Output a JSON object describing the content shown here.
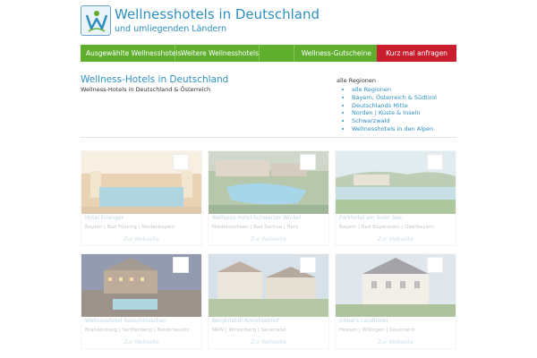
{
  "header": {
    "title": "Wellnesshotels in Deutschland",
    "subtitle": "und umliegenden Ländern",
    "logo_icon": "wellness-logo-icon"
  },
  "nav": {
    "items": [
      {
        "label": "Ausgewählte Wellnesshotels"
      },
      {
        "label": "Weitere Wellnesshotels"
      },
      {
        "label": "Wellness-Gutscheine"
      }
    ],
    "cta_label": "Kurz mal anfragen",
    "colors": {
      "nav_bg": "#5fae2e",
      "cta_bg": "#c81e2e",
      "accent": "#2f8fc0"
    }
  },
  "main": {
    "title": "Wellness-Hotels in Deutschland",
    "subtitle": "Wellness-Hotels in Deutschland & Österreich"
  },
  "regions": {
    "heading": "alle Regionen",
    "items": [
      "alle Regionen",
      "Bayern, Österreich & Südtirol",
      "Deutschlands Mitte",
      "Norden | Küste & Inseln",
      "Schwarzwald",
      "Wellnesshotels in den Alpen"
    ]
  },
  "hotels": [
    {
      "name": "Hotel Erlanger",
      "location": "Bayern | Bad Füssing | Niederbayern",
      "link": "Zur Webseite"
    },
    {
      "name": "Wellness Hotel Schwarzer Winkel",
      "location": "Niedersachsen | Bad Sachsa | Harz",
      "link": "Zur Webseite"
    },
    {
      "name": "Parkhotel am Soier See",
      "location": "Bayern | Bad Bayersoien | Oberbayern",
      "link": "Zur Webseite"
    },
    {
      "name": "Wellnesshotel Seeschlösschen",
      "location": "Brandenburg | Senftenberg | Niederlausitz",
      "link": "Zur Webseite"
    },
    {
      "name": "Bergkristall Annelisenhof",
      "location": "NRW | Winterberg | Sauerland",
      "link": "Zur Webseite"
    },
    {
      "name": "Göbel's Landhotel",
      "location": "Hessen | Willingen | Sauerland",
      "link": "Zur Webseite"
    }
  ]
}
